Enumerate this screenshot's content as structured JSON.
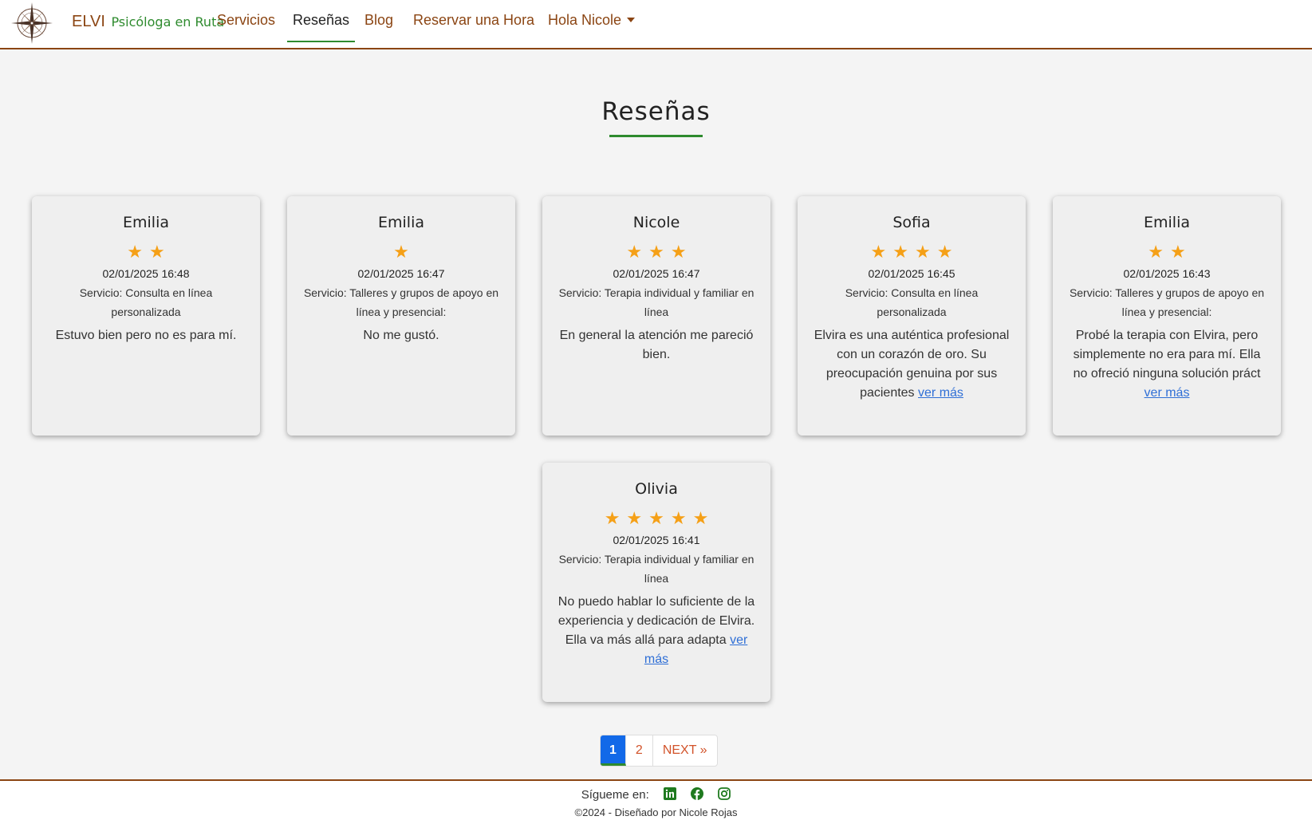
{
  "brand": {
    "name": "ELVI",
    "subtitle": "Psicóloga en Ruta",
    "logo_icon": "compass-rose-icon"
  },
  "nav": {
    "items": [
      {
        "label": "Servicios"
      },
      {
        "label": "Reseñas",
        "active": true
      },
      {
        "label": "Blog"
      },
      {
        "label": "Reservar una Hora"
      }
    ],
    "user_menu": "Hola Nicole"
  },
  "page_title": "Reseñas",
  "reviews": [
    {
      "name": "Emilia",
      "rating": 2,
      "stars": "★★",
      "date": "02/01/2025 16:48",
      "service": "Servicio: Consulta en línea personalizada",
      "comment": "Estuvo bien pero no es para mí.",
      "more": ""
    },
    {
      "name": "Emilia",
      "rating": 1,
      "stars": "★",
      "date": "02/01/2025 16:47",
      "service": "Servicio: Talleres y grupos de apoyo en línea y presencial:",
      "comment": "No me gustó.",
      "more": ""
    },
    {
      "name": "Nicole",
      "rating": 3,
      "stars": "★★★",
      "date": "02/01/2025 16:47",
      "service": "Servicio: Terapia individual y familiar en línea",
      "comment": "En general la atención me pareció bien.",
      "more": ""
    },
    {
      "name": "Sofia",
      "rating": 4,
      "stars": "★★★★",
      "date": "02/01/2025 16:45",
      "service": "Servicio: Consulta en línea personalizada",
      "comment": "Elvira es una auténtica profesional con un corazón de oro. Su preocupación genuina por sus pacientes",
      "more": "ver más"
    },
    {
      "name": "Emilia",
      "rating": 2,
      "stars": "★★",
      "date": "02/01/2025 16:43",
      "service": "Servicio: Talleres y grupos de apoyo en línea y presencial:",
      "comment": "Probé la terapia con Elvira, pero simplemente no era para mí. Ella no ofreció ninguna solución práct",
      "more": "ver más"
    },
    {
      "name": "Olivia",
      "rating": 5,
      "stars": "★★★★★",
      "date": "02/01/2025 16:41",
      "service": "Servicio: Terapia individual y familiar en línea",
      "comment": "No puedo hablar lo suficiente de la experiencia y dedicación de Elvira. Ella va más allá para adapta",
      "more": "ver más"
    }
  ],
  "pagination": {
    "pages": [
      "1",
      "2"
    ],
    "current": "1",
    "next": "NEXT »"
  },
  "footer": {
    "follow": "Sígueme en:",
    "social": [
      "linkedin-icon",
      "facebook-icon",
      "instagram-icon"
    ],
    "copyright": "©2024 - Diseñado por Nicole Rojas"
  },
  "colors": {
    "brand_brown": "#8b4513",
    "accent_green": "#2e8b2e",
    "star": "#f5a017",
    "link_blue": "#2f6fd6",
    "page_active": "#1269e8"
  }
}
